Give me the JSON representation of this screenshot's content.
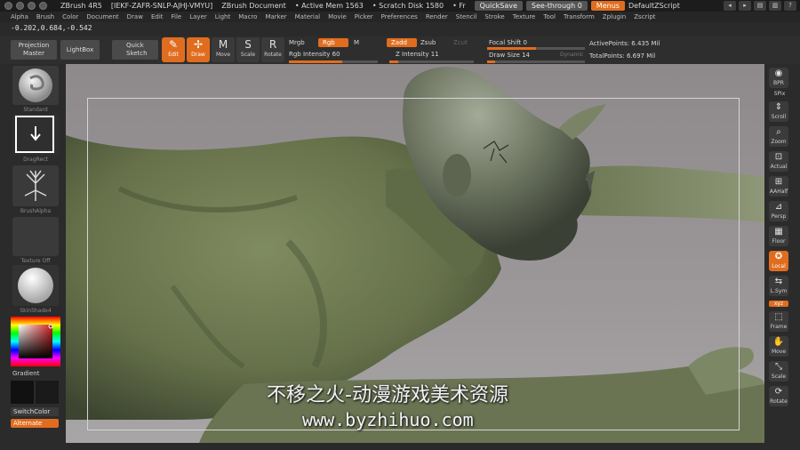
{
  "titlebar": {
    "app": "ZBrush 4R5",
    "serial": "[IEKF-ZAFR-SNLP-AJHJ-VMYU]",
    "document": "ZBrush Document",
    "active_mem": "• Active Mem 1563",
    "scratch_disk": "• Scratch Disk 1580",
    "free": "• Fr",
    "quicksave": "QuickSave",
    "see_through": "See-through  0",
    "menus": "Menus",
    "script": "DefaultZScript"
  },
  "menu": [
    "Alpha",
    "Brush",
    "Color",
    "Document",
    "Draw",
    "Edit",
    "File",
    "Layer",
    "Light",
    "Macro",
    "Marker",
    "Material",
    "Movie",
    "Picker",
    "Preferences",
    "Render",
    "Stencil",
    "Stroke",
    "Texture",
    "Tool",
    "Transform",
    "Zplugin",
    "Zscript"
  ],
  "coords": "-0.202,0.684,-0.542",
  "shelf": {
    "projection_master": "Projection Master",
    "lightbox": "LightBox",
    "quick_sketch": "Quick Sketch",
    "tools": [
      {
        "label": "Edit",
        "glyph": "✎",
        "active": true
      },
      {
        "label": "Draw",
        "glyph": "✢",
        "active": true
      },
      {
        "label": "Move",
        "glyph": "M",
        "active": false
      },
      {
        "label": "Scale",
        "glyph": "S",
        "active": false
      },
      {
        "label": "Rotate",
        "glyph": "R",
        "active": false
      }
    ],
    "mrgb": "Mrgb",
    "rgb": "Rgb",
    "m": "M",
    "rgb_intensity": "Rgb  Intensity 60",
    "zadd": "Zadd",
    "zsub": "Zsub",
    "zcut": "Zcut",
    "z_intensity": "Z  Intensity 11",
    "focal_shift": "Focal  Shift 0",
    "draw_size": "Draw  Size 14",
    "dynamic": "Dynamic",
    "active_points": "ActivePoints: 6.435  Mil",
    "total_points": "TotalPoints: 6.697  Mil"
  },
  "left": {
    "standard": "Standard",
    "dragrect": "DragRect",
    "brushalpha": "BrushAlpha",
    "texture_off": "Texture  Off",
    "skinshade": "SkinShade4",
    "gradient": "Gradient",
    "switchcolor": "SwitchColor",
    "alternate": "Alternate"
  },
  "right": [
    {
      "label": "BPR",
      "glyph": "◉",
      "active": false
    },
    {
      "label": "SPix",
      "glyph": "",
      "active": false
    },
    {
      "label": "Scroll",
      "glyph": "⇕",
      "active": false
    },
    {
      "label": "Zoom",
      "glyph": "⌕",
      "active": false
    },
    {
      "label": "Actual",
      "glyph": "⊡",
      "active": false
    },
    {
      "label": "AAHalf",
      "glyph": "⊞",
      "active": false
    },
    {
      "label": "Persp",
      "glyph": "⊿",
      "active": false
    },
    {
      "label": "Floor",
      "glyph": "▦",
      "active": false
    },
    {
      "label": "Local",
      "glyph": "✪",
      "active": true
    },
    {
      "label": "L.Sym",
      "glyph": "⇆",
      "active": false
    },
    {
      "label": "xyz",
      "glyph": "",
      "active": true
    },
    {
      "label": "Frame",
      "glyph": "⬚",
      "active": false
    },
    {
      "label": "Move",
      "glyph": "✋",
      "active": false
    },
    {
      "label": "Scale",
      "glyph": "⤡",
      "active": false
    },
    {
      "label": "Rotate",
      "glyph": "⟳",
      "active": false
    }
  ],
  "watermark": {
    "line1": "不移之火-动漫游戏美术资源",
    "line2": "www.byzhihuo.com"
  },
  "colors": {
    "accent": "#e06d1f",
    "panel": "#2b2b2b",
    "skin": "#6f7a54"
  }
}
